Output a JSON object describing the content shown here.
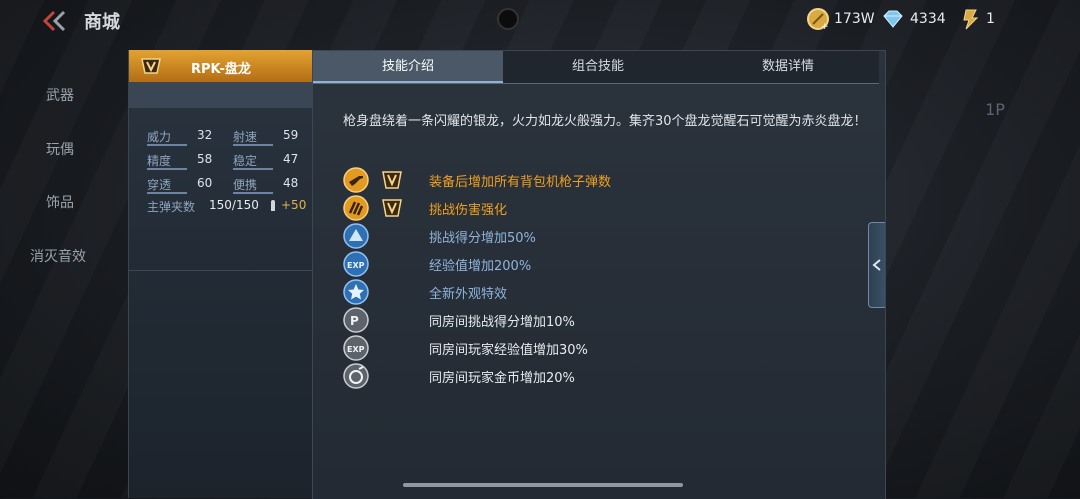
{
  "header": {
    "title": "商城",
    "currencies": [
      {
        "name": "gold-coin",
        "value": "173W"
      },
      {
        "name": "diamond",
        "value": "4334"
      },
      {
        "name": "ticket",
        "value": "1"
      }
    ]
  },
  "sidenav": {
    "items": [
      {
        "label": "武器"
      },
      {
        "label": "玩偶"
      },
      {
        "label": "饰品"
      },
      {
        "label": "消灭音效"
      }
    ]
  },
  "weapon": {
    "name": "RPK-盘龙",
    "stats": [
      {
        "label": "威力",
        "value": "32"
      },
      {
        "label": "射速",
        "value": "59"
      },
      {
        "label": "精度",
        "value": "58"
      },
      {
        "label": "稳定",
        "value": "47"
      },
      {
        "label": "穿透",
        "value": "60"
      },
      {
        "label": "便携",
        "value": "48"
      }
    ],
    "ammo_label": "主弹夹数",
    "ammo_value": "150/150",
    "ammo_bonus": "+50"
  },
  "tabs": [
    {
      "label": "技能介绍",
      "active": true
    },
    {
      "label": "组合技能",
      "active": false
    },
    {
      "label": "数据详情",
      "active": false
    }
  ],
  "description": "枪身盘绕着一条闪耀的银龙，火力如龙火般强力。集齐30个盘龙觉醒石可觉醒为赤炎盘龙！",
  "skills": [
    {
      "icon": "machine-gun-icon",
      "text": "装备后增加所有背包机枪子弹数",
      "color": "#f0a01e",
      "badge": true
    },
    {
      "icon": "claw-icon",
      "text": "挑战伤害强化",
      "color": "#f0a01e",
      "badge": true
    },
    {
      "icon": "score-icon",
      "text": "挑战得分增加50%",
      "color": "#8fb4dc",
      "badge": false
    },
    {
      "icon": "exp-icon",
      "text": "经验值增加200%",
      "color": "#8fb4dc",
      "badge": false
    },
    {
      "icon": "star-icon",
      "text": "全新外观特效",
      "color": "#8fb4dc",
      "badge": false
    },
    {
      "icon": "room-score-icon",
      "text": "同房间挑战得分增加10%",
      "color": "#e8ecf0",
      "badge": false
    },
    {
      "icon": "room-exp-icon",
      "text": "同房间玩家经验值增加30%",
      "color": "#e8ecf0",
      "badge": false
    },
    {
      "icon": "room-coin-icon",
      "text": "同房间玩家金币增加20%",
      "color": "#e8ecf0",
      "badge": false
    }
  ],
  "side": {
    "room_tag": "1P"
  }
}
